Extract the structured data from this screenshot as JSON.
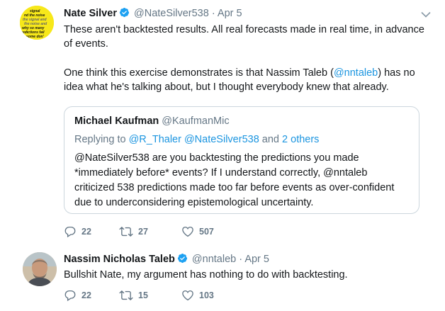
{
  "tweets": [
    {
      "author": "Nate Silver",
      "handle": "@NateSilver538",
      "dot": "·",
      "date": "Apr 5",
      "paragraphs": [
        "These aren't backtested results. All real forecasts made in real time, in advance of events.",
        "One think this exercise demonstrates is that Nassim Taleb (@nntaleb) has no idea what he's talking about, but I thought everybody knew that already."
      ],
      "p2_parts": {
        "before": "One think this exercise demonstrates is that Nassim Taleb (",
        "mention": "@nntaleb",
        "after": ") has no idea what he's talking about, but I thought everybody knew that already."
      },
      "avatar_text": "signal and the noise · why so many predictions fail but some don't",
      "quote": {
        "author": "Michael Kaufman",
        "handle": "@KaufmanMic",
        "replying_prefix": "Replying to",
        "replying_to": "@R_Thaler @NateSilver538",
        "replying_suffix": "and",
        "replying_others": "2 others",
        "text": "@NateSilver538 are you backtesting the predictions you made *immediately before* events? If I understand correctly, @nntaleb criticized 538 predictions made too far before events as over-confident due to underconsidering epistemological uncertainty."
      },
      "actions": {
        "replies": "22",
        "retweets": "27",
        "likes": "507"
      }
    },
    {
      "author": "Nassim Nicholas Taleb",
      "handle": "@nntaleb",
      "dot": "·",
      "date": "Apr 5",
      "text": "Bullshit Nate, my argument has nothing to do with backtesting.",
      "actions": {
        "replies": "22",
        "retweets": "15",
        "likes": "103"
      }
    }
  ],
  "icons": {
    "verified": "verified-badge-icon",
    "caret": "chevron-down-icon",
    "reply": "reply-icon",
    "retweet": "retweet-icon",
    "like": "heart-icon"
  },
  "colors": {
    "link": "#1b95e0",
    "secondary": "#657786",
    "verified": "#1da1f2",
    "border": "#ccd6dd"
  }
}
